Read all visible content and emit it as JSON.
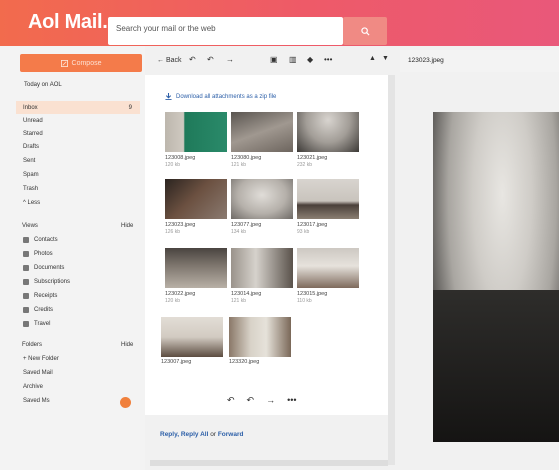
{
  "header": {
    "logo": "Aol Mail.",
    "search_placeholder": "Search your mail or the web"
  },
  "sidebar": {
    "compose_label": "Compose",
    "today_label": "Today on AOL",
    "folders": [
      {
        "label": "Inbox",
        "count": "9"
      },
      {
        "label": "Unread"
      },
      {
        "label": "Starred"
      },
      {
        "label": "Drafts"
      },
      {
        "label": "Sent"
      },
      {
        "label": "Spam"
      },
      {
        "label": "Trash"
      },
      {
        "label": "^ Less"
      }
    ],
    "views_label": "Views",
    "views_hide": "Hide",
    "views": [
      {
        "label": "Contacts"
      },
      {
        "label": "Photos"
      },
      {
        "label": "Documents"
      },
      {
        "label": "Subscriptions"
      },
      {
        "label": "Receipts"
      },
      {
        "label": "Credits"
      },
      {
        "label": "Travel"
      }
    ],
    "folders_label": "Folders",
    "folders_hide": "Hide",
    "custom_folders": [
      {
        "label": "+ New Folder"
      },
      {
        "label": "Saved Mail"
      },
      {
        "label": "Archive"
      },
      {
        "label": "Saved Ms"
      }
    ]
  },
  "toolbar": {
    "back_label": "Back"
  },
  "message": {
    "download_all": "Download all attachments as a zip file",
    "attachments": [
      {
        "name": "123008.jpeg",
        "size": "120 kb"
      },
      {
        "name": "123080.jpeg",
        "size": "121 kb"
      },
      {
        "name": "123021.jpeg",
        "size": "232 kb"
      },
      {
        "name": "123023.jpeg",
        "size": "126 kb"
      },
      {
        "name": "123077.jpeg",
        "size": "134 kb"
      },
      {
        "name": "123017.jpeg",
        "size": "93 kb"
      },
      {
        "name": "123022.jpeg",
        "size": "120 kb"
      },
      {
        "name": "123014.jpeg",
        "size": "121 kb"
      },
      {
        "name": "123015.jpeg",
        "size": "110 kb"
      },
      {
        "name": "123007.jpeg",
        "size": ""
      },
      {
        "name": "123320.jpeg",
        "size": ""
      }
    ],
    "reply": "Reply",
    "reply_all": "Reply All",
    "or_text": "or",
    "forward": "Forward"
  },
  "preview": {
    "filename": "123023.jpeg"
  },
  "colors": {
    "header_start": "#f26b4d",
    "header_end": "#e9587a",
    "compose": "#f47b4a",
    "link": "#2c5fa8"
  }
}
